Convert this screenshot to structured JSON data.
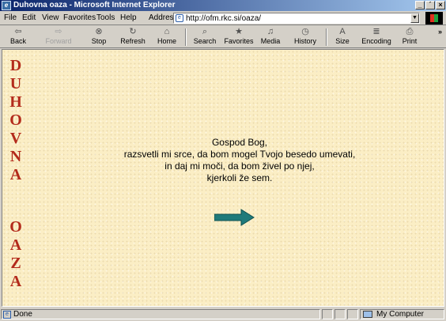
{
  "window": {
    "title": "Duhovna oaza - Microsoft Internet Explorer",
    "app_icon_name": "internet-explorer-icon",
    "controls": [
      "_",
      "´",
      "×"
    ]
  },
  "menu": {
    "items": [
      "File",
      "Edit",
      "View",
      "Favorites",
      "Tools",
      "Help"
    ]
  },
  "address": {
    "label": "Address",
    "url": "http://ofm.rkc.si/oaza/"
  },
  "toolbar": {
    "buttons": [
      {
        "label": "Back",
        "icon": "⇦",
        "icon_name": "back-arrow-icon",
        "enabled": true
      },
      {
        "label": "Forward",
        "icon": "⇨",
        "icon_name": "forward-arrow-icon",
        "enabled": false
      },
      {
        "label": "Stop",
        "icon": "⊗",
        "icon_name": "stop-icon",
        "enabled": true
      },
      {
        "label": "Refresh",
        "icon": "↻",
        "icon_name": "refresh-icon",
        "enabled": true
      },
      {
        "label": "Home",
        "icon": "⌂",
        "icon_name": "home-icon",
        "enabled": true
      },
      {
        "label": "Search",
        "icon": "⌕",
        "icon_name": "search-icon",
        "enabled": true
      },
      {
        "label": "Favorites",
        "icon": "★",
        "icon_name": "favorites-icon",
        "enabled": true
      },
      {
        "label": "Media",
        "icon": "♫",
        "icon_name": "media-icon",
        "enabled": true
      },
      {
        "label": "History",
        "icon": "◷",
        "icon_name": "history-icon",
        "enabled": true
      },
      {
        "label": "Size",
        "icon": "A",
        "icon_name": "text-size-icon",
        "enabled": true
      },
      {
        "label": "Encoding",
        "icon": "≣",
        "icon_name": "encoding-icon",
        "enabled": true
      },
      {
        "label": "Print",
        "icon": "⎙",
        "icon_name": "print-icon",
        "enabled": true
      }
    ],
    "more": "»"
  },
  "page": {
    "vertical_title": [
      "D",
      "U",
      "H",
      "O",
      "V",
      "N",
      "A",
      "O",
      "A",
      "Z",
      "A"
    ],
    "poem": [
      "Gospod Bog,",
      "razsvetli mi srce, da bom mogel Tvojo besedo umevati,",
      "in daj mi moči, da bom živel po njej,",
      "kjerkoli že sem."
    ],
    "arrow_icon_name": "next-arrow-icon",
    "colors": {
      "background": "#fbeec5",
      "title_letters": "#b32a1b",
      "arrow": "#1f7a7a"
    }
  },
  "status": {
    "text": "Done",
    "zone": "My Computer"
  }
}
